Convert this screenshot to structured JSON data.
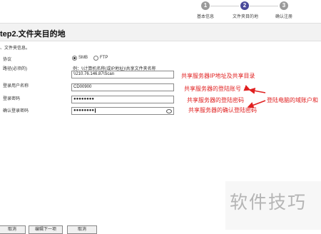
{
  "steps": [
    {
      "num": "1",
      "label": "基本信息",
      "color": "#9a9a9a"
    },
    {
      "num": "2",
      "label": "文件夹目的地",
      "color": "#4a4a9a"
    },
    {
      "num": "3",
      "label": "确认注册",
      "color": "#9a9a9a"
    }
  ],
  "page": {
    "title": "tep2.文件夹目的地"
  },
  "form": {
    "intro": "、文件夹信息。",
    "protocol_label": "协议",
    "protocol_options": [
      "SMB",
      "FTP"
    ],
    "protocol_selected": "SMB",
    "path_label": "路径(必须的)",
    "path_hint": "例：\\\\计算机名称(或IP地址)\\共享文件夹名称",
    "path_value": "\\\\210.76.146.87\\Scan",
    "username_label": "登录用户名称",
    "username_value": "CD00900",
    "password_label": "登录密码",
    "password_value": "●●●●●●●●",
    "confirm_label": "确认登录密码",
    "confirm_value": "●●●●●●●●"
  },
  "annotations": {
    "path": "共享服务器IP地址及共享目录",
    "username": "共享服务器的登陆账号",
    "password": "共享服务器的登陆密码",
    "confirm": "共享服务器的确认登陆密码",
    "side": "登陆电脑的域账户和"
  },
  "buttons": [
    "取消",
    "编辑下一项",
    "取消"
  ],
  "watermark": "软件技巧",
  "colors": {
    "annotation": "#e02020",
    "arrow": "#e02020"
  }
}
